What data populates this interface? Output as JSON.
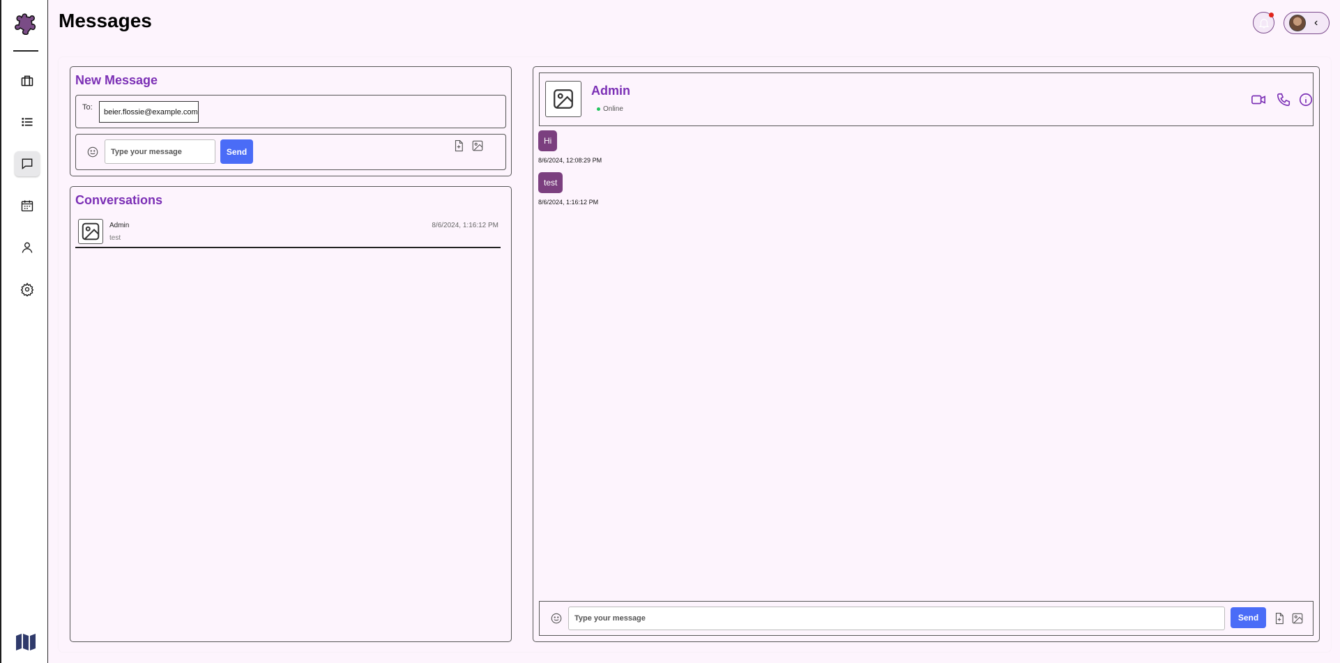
{
  "page": {
    "title": "Messages"
  },
  "sidebar": {
    "items": [
      {
        "name": "briefcase-icon",
        "active": false
      },
      {
        "name": "list-icon",
        "active": false
      },
      {
        "name": "chat-icon",
        "active": true
      },
      {
        "name": "calendar-icon",
        "active": false
      },
      {
        "name": "user-icon",
        "active": false
      },
      {
        "name": "gear-icon",
        "active": false
      }
    ]
  },
  "colors": {
    "accent": "#7b2fb5",
    "bubble": "#7b3f7f",
    "send": "#4a6cf7",
    "online": "#22c55e",
    "notification": "#e0241b"
  },
  "new_message": {
    "title": "New Message",
    "to_label": "To:",
    "to_value": "beier.flossie@example.com",
    "message_placeholder": "Type your message",
    "send_label": "Send"
  },
  "conversations": {
    "title": "Conversations",
    "items": [
      {
        "name": "Admin",
        "last_message": "test",
        "timestamp": "8/6/2024, 1:16:12 PM"
      }
    ]
  },
  "chat": {
    "contact_name": "Admin",
    "status": "Online",
    "messages": [
      {
        "text": "Hi",
        "timestamp": "8/6/2024, 12:08:29 PM"
      },
      {
        "text": "test",
        "timestamp": "8/6/2024, 1:16:12 PM"
      }
    ],
    "message_placeholder": "Type your message",
    "send_label": "Send"
  }
}
